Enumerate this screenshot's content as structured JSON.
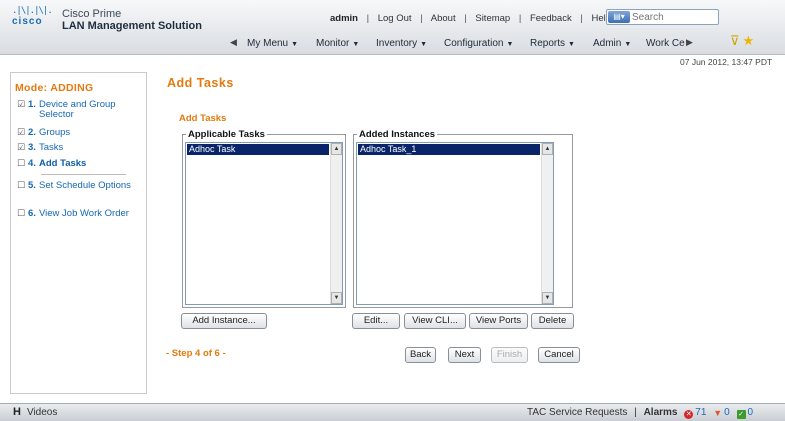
{
  "header": {
    "logo_text": "cisco",
    "product_line1": "Cisco Prime",
    "product_line2": "LAN Management Solution",
    "user": "admin",
    "links": [
      "Log Out",
      "About",
      "Sitemap",
      "Feedback",
      "Help"
    ],
    "search_placeholder": "Search",
    "nav": [
      "My Menu",
      "Monitor",
      "Inventory",
      "Configuration",
      "Reports",
      "Admin",
      "Work Ce"
    ],
    "timestamp": "07 Jun 2012, 13:47 PDT"
  },
  "sidebar": {
    "mode": "Mode: ADDING",
    "steps": [
      {
        "num": "1.",
        "label": "Device and Group Selector",
        "done": true
      },
      {
        "num": "2.",
        "label": "Groups",
        "done": true
      },
      {
        "num": "3.",
        "label": "Tasks",
        "done": true
      },
      {
        "num": "4.",
        "label": "Add Tasks",
        "done": false,
        "current": true
      },
      {
        "num": "5.",
        "label": "Set Schedule Options",
        "done": false
      },
      {
        "num": "6.",
        "label": "View Job Work Order",
        "done": false
      }
    ]
  },
  "main": {
    "page_title": "Add Tasks",
    "section_title": "Add Tasks",
    "applicable": {
      "label": "Applicable Tasks",
      "items": [
        "Adhoc Task"
      ]
    },
    "added": {
      "label": "Added Instances",
      "items": [
        "Adhoc Task_1"
      ]
    },
    "buttons": {
      "add_instance": "Add Instance...",
      "edit": "Edit...",
      "view_cli": "View CLI...",
      "view_ports": "View Ports",
      "delete": "Delete",
      "back": "Back",
      "next": "Next",
      "finish": "Finish",
      "cancel": "Cancel"
    },
    "step_indicator": "- Step 4 of 6 -"
  },
  "footer": {
    "videos": "Videos",
    "tac": "TAC Service Requests",
    "alarms_label": "Alarms",
    "alarm_critical": "71",
    "alarm_major": "0",
    "alarm_ok": "0"
  },
  "colors": {
    "accent": "#e37a0f",
    "link": "#1467b3",
    "selection": "#0a246a"
  }
}
